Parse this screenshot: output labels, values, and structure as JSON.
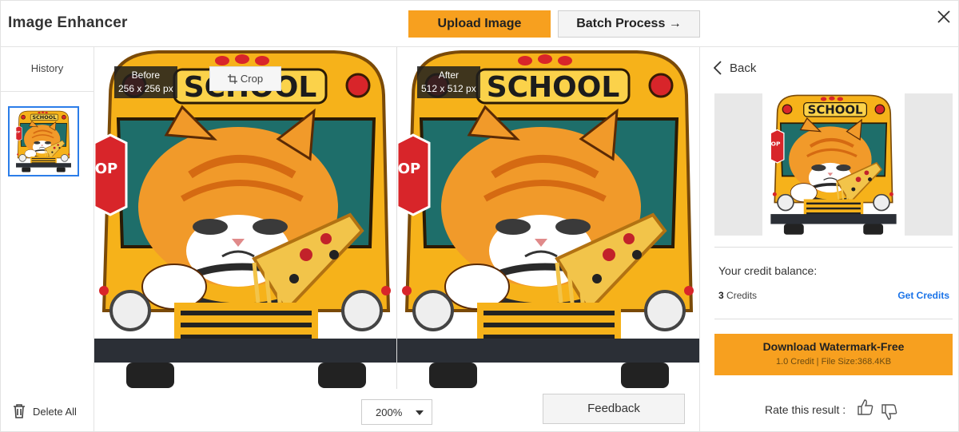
{
  "app": {
    "title": "Image Enhancer"
  },
  "header": {
    "upload_label": "Upload Image",
    "batch_label": "Batch Process →"
  },
  "sidebar": {
    "history_label": "History",
    "delete_all_label": "Delete All"
  },
  "compare": {
    "before_label": "Before",
    "before_size": "256 x 256 px",
    "after_label": "After",
    "after_size": "512 x 512 px",
    "crop_label": "Crop",
    "school_text": "SCHOOL",
    "stop_text": "OP",
    "zoom_value": "200%",
    "feedback_label": "Feedback"
  },
  "right_panel": {
    "back_label": "Back",
    "credit_balance_label": "Your credit balance:",
    "credits_count": "3",
    "credits_unit": "Credits",
    "get_credits_label": "Get Credits",
    "download_label": "Download Watermark-Free",
    "download_sub": "1.0 Credit | File Size:368.4KB",
    "rate_label": "Rate this result :"
  },
  "colors": {
    "accent_orange": "#f7a01f",
    "link_blue": "#1a73e8",
    "bus_yellow": "#f6b21a",
    "cat_orange": "#f19a2a"
  },
  "icons": [
    "close-icon",
    "trash-icon",
    "crop-icon",
    "chevron-left-icon",
    "thumbs-up-icon",
    "thumbs-down-icon",
    "dropdown-caret-icon"
  ]
}
